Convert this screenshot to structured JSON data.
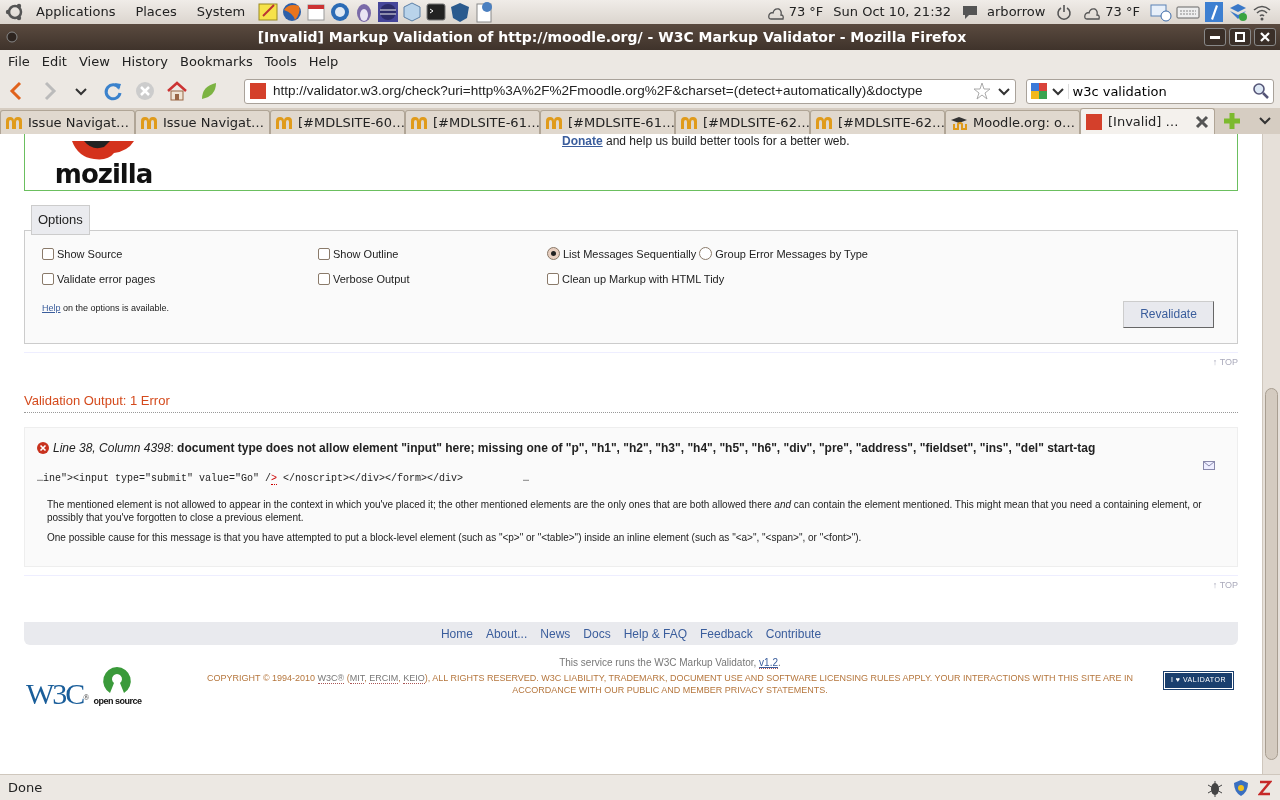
{
  "top_panel": {
    "menus": [
      "Applications",
      "Places",
      "System"
    ],
    "weather": "73 °F",
    "clock": "Sun Oct 10, 21:32",
    "user": "arborrow",
    "weather_2": "73 °F"
  },
  "window": {
    "title": "[Invalid] Markup Validation of http://moodle.org/ - W3C Markup Validator - Mozilla Firefox"
  },
  "menu_bar": [
    "File",
    "Edit",
    "View",
    "History",
    "Bookmarks",
    "Tools",
    "Help"
  ],
  "toolbar": {
    "url": "http://validator.w3.org/check?uri=http%3A%2F%2Fmoodle.org%2F&charset=(detect+automatically)&doctype",
    "search": "w3c validation"
  },
  "tabs": [
    {
      "label": "Issue Navigat…",
      "kind": "arch",
      "selected": false
    },
    {
      "label": "Issue Navigat…",
      "kind": "arch",
      "selected": false
    },
    {
      "label": "[#MDLSITE-60…",
      "kind": "arch",
      "selected": false
    },
    {
      "label": "[#MDLSITE-61…",
      "kind": "arch",
      "selected": false
    },
    {
      "label": "[#MDLSITE-61…",
      "kind": "arch",
      "selected": false
    },
    {
      "label": "[#MDLSITE-62…",
      "kind": "arch",
      "selected": false
    },
    {
      "label": "[#MDLSITE-62…",
      "kind": "arch",
      "selected": false
    },
    {
      "label": "Moodle.org: o…",
      "kind": "cap",
      "selected": false
    },
    {
      "label": "[Invalid] …",
      "kind": "square",
      "selected": true
    }
  ],
  "header": {
    "logo_text": "mozilla",
    "donate": "Donate",
    "donate_rest": " and help us build better tools for a better web."
  },
  "options": {
    "legend": "Options",
    "rows": [
      {
        "columns": [
          {
            "controls": [
              {
                "kind": "checkbox",
                "label": "Show Source",
                "checked": false
              }
            ]
          },
          {
            "controls": [
              {
                "kind": "checkbox",
                "label": "Show Outline",
                "checked": false
              }
            ]
          },
          {
            "controls": [
              {
                "kind": "radio",
                "label": "List Messages Sequentially",
                "selected": true
              },
              {
                "kind": "radio",
                "label": "Group Error Messages by Type",
                "selected": false
              }
            ]
          }
        ]
      },
      {
        "columns": [
          {
            "controls": [
              {
                "kind": "checkbox",
                "label": "Validate error pages",
                "checked": false
              }
            ]
          },
          {
            "controls": [
              {
                "kind": "checkbox",
                "label": "Verbose Output",
                "checked": false
              }
            ]
          },
          {
            "controls": [
              {
                "kind": "checkbox",
                "label": "Clean up Markup with HTML Tidy",
                "checked": false
              }
            ]
          }
        ]
      }
    ],
    "help_link": "Help",
    "help_text": " on the options is available.",
    "button": "Revalidate"
  },
  "top_link_1": "↑ TOP",
  "output": {
    "heading": "Validation Output: 1 Error",
    "messages": [
      {
        "kind": "error",
        "title": "*Line 38, Column 4398*: **document type does not allow element \"input\" here; missing one of \"p\", \"h1\", \"h2\", \"h3\", \"h4\", \"h5\", \"h6\", \"div\", \"pre\", \"address\", \"fieldset\", \"ins\", \"del\" start-tag**",
        "code": {
          "before": "…ine\"><input type=\"submit\" value=\"Go\" /",
          "marked": ">",
          "after": " </noscript></div></form></div>",
          "tail": "…"
        },
        "paragraphs": [
          "The mentioned element is not allowed to appear in the context in which you've placed it; the other mentioned elements are the only ones that are both allowed there *and* can contain the element mentioned. This might mean that you need a containing element, or possibly that you've forgotten to close a previous element.",
          "One possible cause for this message is that you have attempted to put a block-level element (such as \"<p>\" or \"<table>\") inside an inline element (such as \"<a>\", \"<span>\", or \"<font>\")."
        ]
      }
    ]
  },
  "top_link_2": "↑ TOP",
  "footer": {
    "nav": [
      "Home",
      "About...",
      "News",
      "Docs",
      "Help & FAQ",
      "Feedback",
      "Contribute"
    ],
    "w3c_logo": "W3C",
    "w3c_mark": "®",
    "open_source": "open source",
    "service": [
      "This service runs the W3C Markup Validator, ",
      "v1.2",
      "."
    ],
    "copyright": [
      "COPYRIGHT © 1994-2010 ",
      "W3C®",
      " (",
      "MIT",
      ", ",
      "ERCIM",
      ", ",
      "KEIO",
      "), ALL RIGHTS RESERVED. W3C LIABILITY, TRADEMARK, DOCUMENT USE AND SOFTWARE LICENSING RULES APPLY. YOUR INTERACTIONS WITH THIS SITE ARE IN ACCORDANCE WITH OUR PUBLIC AND MEMBER PRIVACY STATEMENTS."
    ],
    "badge": "I ♥ VALIDATOR"
  },
  "status_bar": "Done"
}
